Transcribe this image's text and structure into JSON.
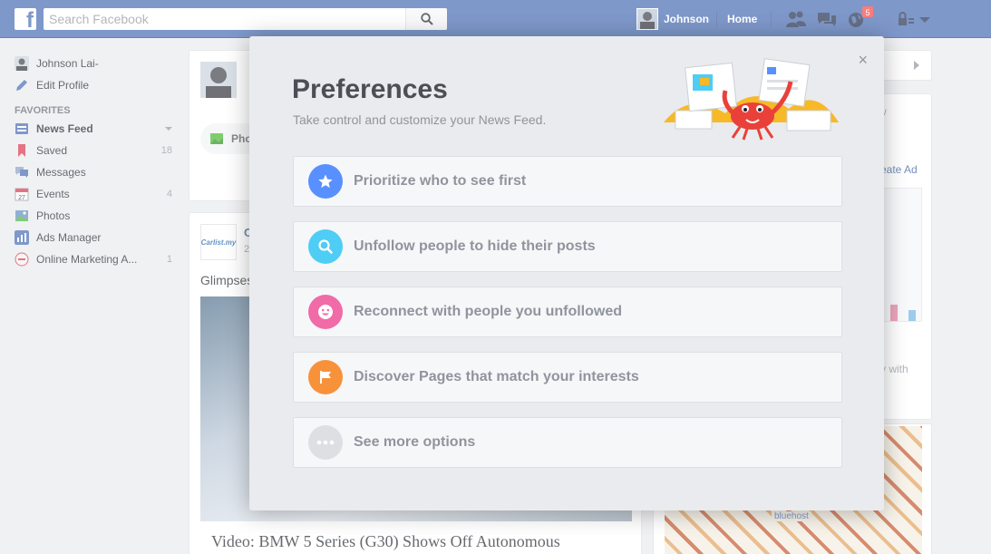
{
  "topbar": {
    "logo_letter": "f",
    "search_placeholder": "Search Facebook",
    "user_name": "Johnson",
    "home_label": "Home",
    "notification_count": "5",
    "brand_color": "#4267b2"
  },
  "sidebar": {
    "profile_name": "Johnson Lai-",
    "edit_profile": "Edit Profile",
    "favorites_heading": "FAVORITES",
    "items": [
      {
        "label": "News Feed",
        "count": "",
        "icon": "news-feed-icon"
      },
      {
        "label": "Saved",
        "count": "18",
        "icon": "bookmark-icon"
      },
      {
        "label": "Messages",
        "count": "",
        "icon": "messages-icon"
      },
      {
        "label": "Events",
        "count": "4",
        "icon": "calendar-icon"
      },
      {
        "label": "Photos",
        "count": "",
        "icon": "photos-icon"
      },
      {
        "label": "Ads Manager",
        "count": "",
        "icon": "chart-icon"
      },
      {
        "label": "Online Marketing A...",
        "count": "1",
        "icon": "group-icon"
      }
    ]
  },
  "feed": {
    "composer_photo_label": "Phot",
    "post_text": "Glimpses",
    "post_page_logo": "Carlist.my",
    "post_initial": "C",
    "post_time": "2",
    "article_title": "Video: BMW 5 Series (G30) Shows Off Autonomous"
  },
  "right_column": {
    "create_ad": "eate Ad",
    "text_w": "w",
    "text_with": "y with",
    "ad_brand": "bluehost"
  },
  "dialog": {
    "title": "Preferences",
    "subtitle": "Take control and customize your News Feed.",
    "close_symbol": "×",
    "options": [
      {
        "label": "Prioritize who to see first",
        "color": "#5890ff",
        "icon": "star-icon"
      },
      {
        "label": "Unfollow people to hide their posts",
        "color": "#4ecdf5",
        "icon": "search-icon"
      },
      {
        "label": "Reconnect with people you unfollowed",
        "color": "#f06ba8",
        "icon": "smiley-icon"
      },
      {
        "label": "Discover Pages that match your interests",
        "color": "#f7923a",
        "icon": "flag-icon"
      },
      {
        "label": "See more options",
        "color": "#dddfe2",
        "icon": "more-icon"
      }
    ]
  }
}
